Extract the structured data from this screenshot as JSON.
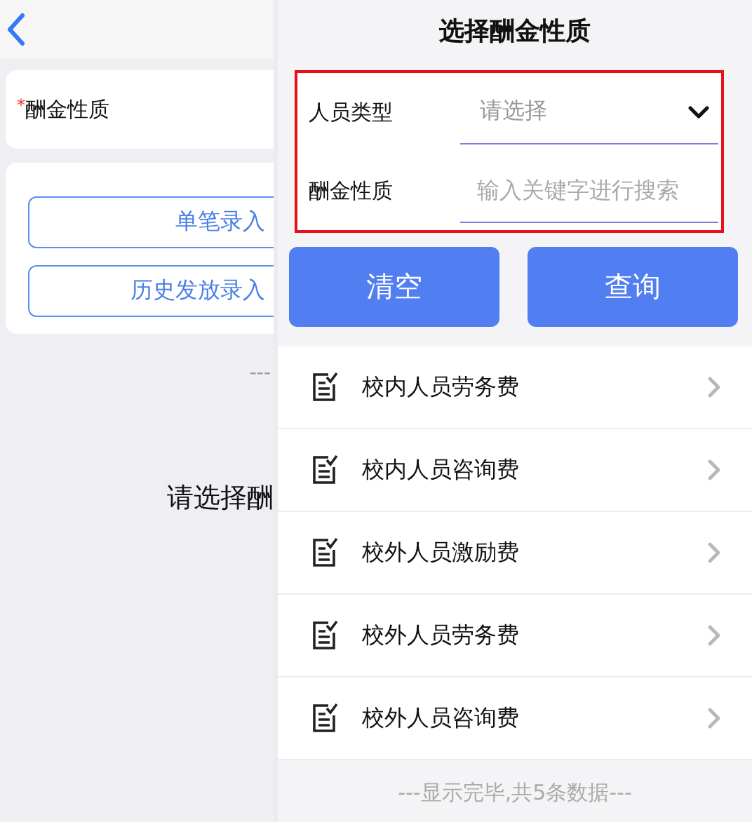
{
  "back_page": {
    "field": {
      "label": "酬金性质",
      "required_mark": "*"
    },
    "buttons": [
      "单笔录入",
      "历史发放录入"
    ],
    "footer": "---",
    "prompt": "请选择酬"
  },
  "drawer": {
    "title": "选择酬金性质",
    "filter": {
      "highlighted": true,
      "fields": [
        {
          "kind": "select",
          "label": "人员类型",
          "placeholder": "请选择"
        },
        {
          "kind": "text",
          "label": "酬金性质",
          "placeholder": "输入关键字进行搜索"
        }
      ]
    },
    "buttons": [
      "清空",
      "查询"
    ],
    "items": [
      {
        "label": "校内人员劳务费"
      },
      {
        "label": "校内人员咨询费"
      },
      {
        "label": "校外人员激励费"
      },
      {
        "label": "校外人员劳务费"
      },
      {
        "label": "校外人员咨询费"
      }
    ],
    "footer": "---显示完毕,共5条数据---"
  }
}
